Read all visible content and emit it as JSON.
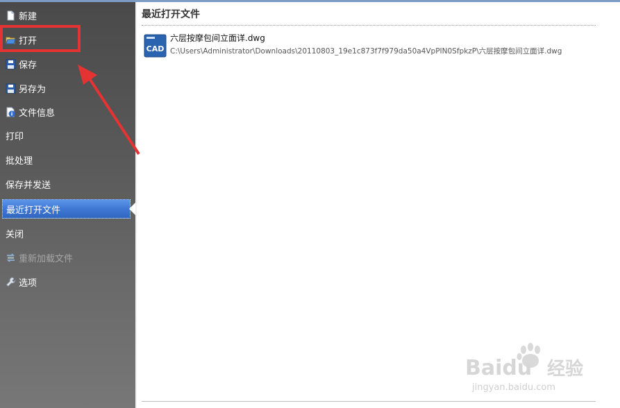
{
  "sidebar": {
    "items": [
      {
        "label": "新建",
        "icon": "new-file-icon"
      },
      {
        "label": "打开",
        "icon": "open-folder-icon"
      },
      {
        "label": "保存",
        "icon": "save-icon"
      },
      {
        "label": "另存为",
        "icon": "save-as-icon"
      },
      {
        "label": "文件信息",
        "icon": "file-info-icon"
      },
      {
        "label": "打印"
      },
      {
        "label": "批处理"
      },
      {
        "label": "保存并发送"
      },
      {
        "label": "最近打开文件",
        "selected": true
      },
      {
        "label": "关闭"
      },
      {
        "label": "重新加载文件",
        "icon": "reload-icon",
        "disabled": true
      },
      {
        "label": "选项",
        "icon": "wrench-icon"
      }
    ]
  },
  "main": {
    "title": "最近打开文件",
    "recent_files": [
      {
        "name": "六层按摩包间立面详.dwg",
        "path": "C:\\Users\\Administrator\\Downloads\\20110803_19e1c873f7f979da50a4VpPIN0SfpkzP\\六层按摩包间立面详.dwg",
        "icon_text": "CAD"
      }
    ]
  },
  "watermark": {
    "brand": "Baidu",
    "suffix": "经验",
    "url": "jingyan.baidu.com"
  },
  "colors": {
    "highlight_red": "#e53333",
    "selected_blue": "#3f78d4",
    "cad_icon_blue": "#2a64b0"
  }
}
